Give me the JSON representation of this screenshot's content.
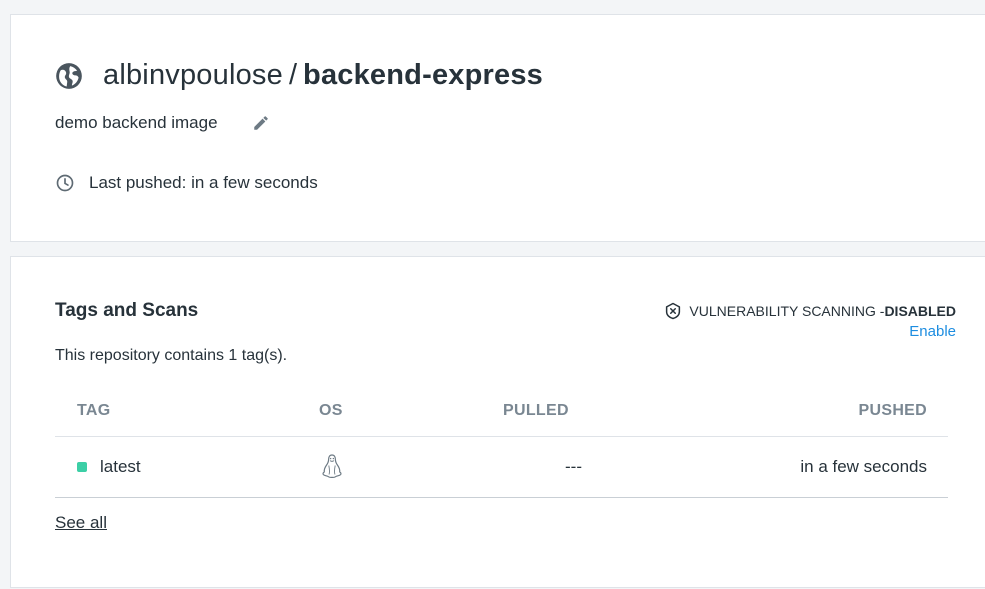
{
  "repository": {
    "owner": "albinvpoulose",
    "separator": "/",
    "name": "backend-express",
    "description": "demo backend image",
    "last_pushed": "Last pushed: in a few seconds",
    "visibility_icon": "globe-icon",
    "edit_icon": "pencil-icon"
  },
  "tags_section": {
    "title": "Tags and Scans",
    "tag_count_text": "This repository contains 1 tag(s).",
    "vulnerability": {
      "label": "VULNERABILITY SCANNING - ",
      "status": "DISABLED",
      "enable_label": "Enable"
    },
    "table": {
      "headers": {
        "tag": "TAG",
        "os": "OS",
        "pulled": "PULLED",
        "pushed": "PUSHED"
      },
      "rows": [
        {
          "tag": "latest",
          "os": "linux-icon",
          "pulled": "---",
          "pushed": "in a few seconds"
        }
      ]
    },
    "see_all_label": "See all"
  },
  "colors": {
    "accent_link": "#1d8de0",
    "tag_status": "#3ccfa6",
    "text": "#27323a",
    "header_text": "#7a8792"
  }
}
